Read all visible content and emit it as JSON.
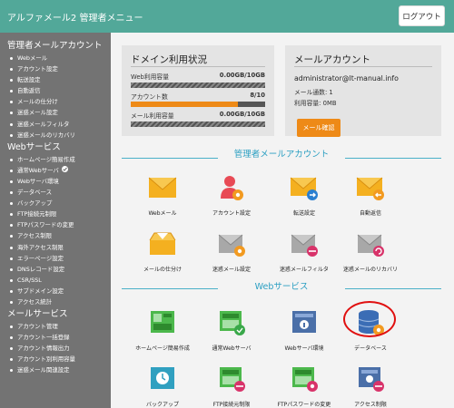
{
  "app": {
    "title": "アルファメール2 管理者メニュー",
    "logout_label": "ログアウト"
  },
  "sidebar": {
    "sections": [
      {
        "heading": "管理者メールアカウント",
        "items": [
          "Webメール",
          "アカウント設定",
          "転送設定",
          "自動返信",
          "メールの仕分け",
          "迷惑メール設定",
          "迷惑メールフィルタ",
          "迷惑メールのリカバリ"
        ]
      },
      {
        "heading": "Webサービス",
        "items": [
          "ホームページ簡易作成",
          "通常Webサーバ",
          "Webサーバ環境",
          "データベース",
          "バックアップ",
          "FTP接続元制限",
          "FTPパスワードの変更",
          "アクセス制限",
          "海外アクセス制限",
          "エラーページ設定",
          "DNSレコード設定",
          "CSR/SSL",
          "サブドメイン設定",
          "アクセス統計"
        ]
      },
      {
        "heading": "メールサービス",
        "items": [
          "アカウント管理",
          "アカウント一括登録",
          "アカウント情報出力",
          "アカウント別利用容量",
          "迷惑メール関連設定"
        ]
      }
    ]
  },
  "domain_usage": {
    "title": "ドメイン利用状況",
    "rows": [
      {
        "label": "Web利用容量",
        "value": "0.00GB/10GB"
      },
      {
        "label": "アカウント数",
        "value": "8/10"
      },
      {
        "label": "メール利用容量",
        "value": "0.00GB/10GB"
      }
    ],
    "account_fill": 0.8
  },
  "mail_account": {
    "title": "メールアカウント",
    "address": "administrator@lt-manual.info",
    "count_line": "メール通数: 1",
    "usage_line": "利用容量: 0MB",
    "confirm_label": "メール確認"
  },
  "admin_section": {
    "title": "管理者メールアカウント",
    "tiles": [
      {
        "label": "Webメール",
        "icon": "web-mail-icon"
      },
      {
        "label": "アカウント設定",
        "icon": "account-settings-icon"
      },
      {
        "label": "転送設定",
        "icon": "forwarding-icon"
      },
      {
        "label": "自動返信",
        "icon": "auto-reply-icon"
      },
      {
        "label": "メールの仕分け",
        "icon": "mail-sort-icon"
      },
      {
        "label": "迷惑メール設定",
        "icon": "spam-settings-icon"
      },
      {
        "label": "迷惑メールフィルタ",
        "icon": "spam-filter-icon"
      },
      {
        "label": "迷惑メールのリカバリ",
        "icon": "spam-recovery-icon"
      }
    ]
  },
  "web_section": {
    "title": "Webサービス",
    "tiles": [
      {
        "label": "ホームページ簡易作成",
        "icon": "homepage-builder-icon"
      },
      {
        "label": "通常Webサーバ",
        "icon": "web-server-icon"
      },
      {
        "label": "Webサーバ環境",
        "icon": "server-env-icon"
      },
      {
        "label": "データベース",
        "icon": "database-icon"
      },
      {
        "label": "バックアップ",
        "icon": "backup-icon"
      },
      {
        "label": "FTP接続元制限",
        "icon": "ftp-restrict-icon"
      },
      {
        "label": "FTPパスワードの変更",
        "icon": "ftp-password-icon"
      },
      {
        "label": "アクセス制限",
        "icon": "access-restrict-icon"
      }
    ]
  },
  "colors": {
    "header": "#52a899",
    "sidebar": "#737373",
    "accent_orange": "#ee8a17",
    "section_blue": "#2b9fc2",
    "highlight_red": "#e01010"
  }
}
